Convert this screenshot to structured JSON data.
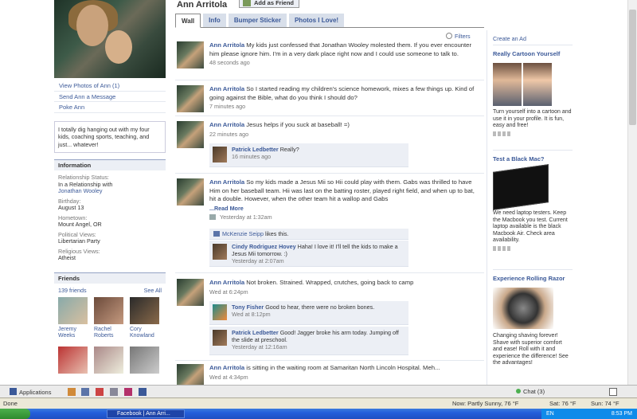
{
  "profile": {
    "name": "Ann Arritola",
    "add_friend": "Add as Friend",
    "tabs": [
      "Wall",
      "Info",
      "Bumper Sticker",
      "Photos I Love!"
    ],
    "links": [
      "View Photos of Ann (1)",
      "Send Ann a Message",
      "Poke Ann"
    ],
    "bio": "I totally dig hanging out with my four kids, coaching sports, teaching, and just... whatever!",
    "info_heading": "Information",
    "info": {
      "rel_label": "Relationship Status:",
      "rel_value": "In a Relationship with",
      "rel_partner": "Jonathan Wooley",
      "bday_label": "Birthday:",
      "bday_value": "August 13",
      "home_label": "Hometown:",
      "home_value": "Mount Angel, OR",
      "pol_label": "Political Views:",
      "pol_value": "Libertarian Party",
      "rel2_label": "Religious Views:",
      "rel2_value": "Atheist"
    },
    "friends_heading": "Friends",
    "friends_count": "139 friends",
    "see_all": "See All",
    "friends": [
      {
        "first": "Jeremy",
        "last": "Weeks"
      },
      {
        "first": "Rachel",
        "last": "Roberts"
      },
      {
        "first": "Cory",
        "last": "Knowland"
      }
    ]
  },
  "filters": "Filters",
  "feed": {
    "s1": {
      "name": "Ann Arritola",
      "text": "My kids just confessed that Jonathan Wooley molested them. If you ever encounter him please ignore him. I'm in a very dark place right now and I could use someone to talk to.",
      "time": "48 seconds ago"
    },
    "s2": {
      "name": "Ann Arritola",
      "text": "So I started reading my children's science homework, mixes a few things up. Kind of going against the Bible, what do you think I should do?",
      "time": "7 minutes ago"
    },
    "s3": {
      "name": "Ann Arritola",
      "text": "Jesus helps if you suck at baseball! =)",
      "time": "22 minutes ago"
    },
    "c3": {
      "name": "Patrick Ledbetter",
      "text": "Really?",
      "time": "16 minutes ago"
    },
    "s4": {
      "name": "Ann Arritola",
      "text": "So my kids made a Jesus Mii so Hii could play with them. Gabs was thrilled to have Him on her baseball team. Hii was last on the batting roster, played right field, and when up to bat, hit a double. However, when the other team hit a wallop and Gabs",
      "more": "...Read More",
      "time": "Yesterday at 1:32am"
    },
    "l4": {
      "name": "McKenzie Seipp",
      "text": "likes this."
    },
    "c4": {
      "name": "Cindy Rodriguez Hovey",
      "text": "Haha! I love it! I'll tell the kids to make a Jesus Mii tomorrow. :)",
      "time": "Yesterday at 2:07am"
    },
    "s5": {
      "name": "Ann Arritola",
      "text": "Not broken. Strained. Wrapped, crutches, going back to camp",
      "time": "Wed at 6:24pm"
    },
    "c5a": {
      "name": "Tony Fisher",
      "text": "Good to hear, there were no broken bones.",
      "time": "Wed at 8:12pm"
    },
    "c5b": {
      "name": "Patrick Ledbetter",
      "text": "Good! Jagger broke his arm today. Jumping off the slide at preschool.",
      "time": "Yesterday at 12:16am"
    },
    "s6": {
      "name": "Ann Arritola",
      "text": "is sitting in the waiting room at Samaritan North Lincoln Hospital. Meh...",
      "time": "Wed at 4:34pm"
    }
  },
  "ads": {
    "create": "Create an Ad",
    "a1": {
      "title": "Really Cartoon Yourself",
      "desc": "Turn yourself into a cartoon and use it in your profile. It is fun, easy and free!"
    },
    "a2": {
      "title": "Test a Black Mac?",
      "desc": "We need laptop testers. Keep the Macbook you test. Current laptop available is the black Macbook Air. Check area availability."
    },
    "a3": {
      "title": "Experience Rolling Razor",
      "desc": "Changing shaving forever! Shave with superior comfort and ease! Roll with it and experience the difference! See the advantages!"
    }
  },
  "fbbar": {
    "applications": "Applications",
    "chat": "Chat (3)"
  },
  "statusbar": {
    "done": "Done",
    "weather1": "Now: Partly Sunny, 76 °F",
    "weather2": "Sat: 76 °F",
    "weather3": "Sun: 74 °F"
  },
  "taskbar": {
    "task": "Facebook | Ann Arri...",
    "lang": "EN",
    "clock": "8:53 PM"
  },
  "colors": {
    "link": "#3b5998",
    "tab_bg": "#d8dfea",
    "comment_bg": "#eceff5"
  }
}
